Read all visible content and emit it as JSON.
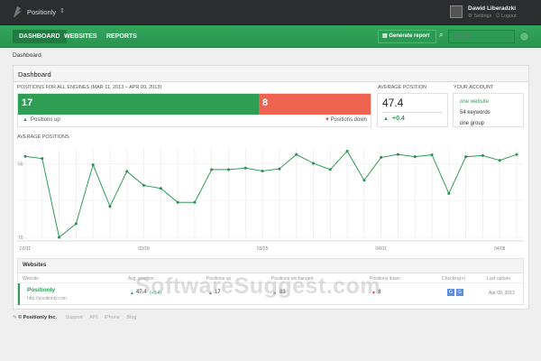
{
  "app": {
    "name": "Positionly",
    "user": "Dawid Liberadzki",
    "settings": "Settings",
    "logout": "Logout"
  },
  "nav": {
    "items": [
      "DASHBOARD",
      "WEBSITES",
      "REPORTS"
    ],
    "generate": "Generate report",
    "search_placeholder": "Search ..."
  },
  "breadcrumb": "Dashboard",
  "panel_title": "Dashboard",
  "positions": {
    "label": "POSITIONS FOR ALL ENGINES (MAR 11, 2013 – APR 09, 2013)",
    "up": "17",
    "down": "8",
    "up_label": "Positions up",
    "down_label": "Positions down",
    "up_fraction": 0.68
  },
  "avg": {
    "label": "AVERAGE POSITION",
    "value": "47.4",
    "change": "+0.4"
  },
  "account": {
    "label": "YOUR ACCOUNT",
    "items": [
      "one website",
      "54 keywords",
      "one group"
    ]
  },
  "colors": {
    "green": "#2e9e55",
    "red": "#ee6350",
    "dark": "#2b2d31"
  },
  "chart_data": {
    "type": "line",
    "title": "AVERAGE POSITIONS",
    "x_ticks": [
      "03/11",
      "03/18",
      "03/25",
      "04/01",
      "04/08"
    ],
    "x_tick_index": [
      0,
      7,
      14,
      21,
      28
    ],
    "y_ticks": [
      "50",
      "70"
    ],
    "y_tick_values": [
      50,
      70
    ],
    "ylim": [
      45.5,
      70.5
    ],
    "y_inverted": true,
    "values": [
      48.0,
      48.6,
      70.0,
      66.3,
      50.3,
      61.6,
      52.1,
      55.9,
      56.7,
      60.5,
      60.5,
      51.6,
      51.6,
      51.2,
      52.0,
      51.4,
      47.5,
      49.9,
      51.6,
      46.6,
      54.5,
      48.3,
      47.5,
      48.1,
      47.6,
      58.1,
      48.1,
      47.8,
      49.1,
      47.5
    ]
  },
  "websites": {
    "title": "Websites",
    "columns": [
      "Website",
      "Avg. position",
      "Positions up",
      "Positions unchanged",
      "Positions down",
      "Checking in",
      "Last update"
    ],
    "rows": [
      {
        "name": "Positionly",
        "url": "http://positionly.com",
        "avg": "47.4",
        "avg_change": "(+0.4)",
        "up": "17",
        "unchanged": "83",
        "down": "8",
        "engines": [
          "G",
          "G"
        ],
        "updated": "Apr 09, 2013"
      }
    ]
  },
  "footer": {
    "copyright": "© Positionly Inc.",
    "links": [
      "Support",
      "API",
      "iPhone",
      "Blog"
    ]
  },
  "watermark": "SoftwareSuggest.com"
}
